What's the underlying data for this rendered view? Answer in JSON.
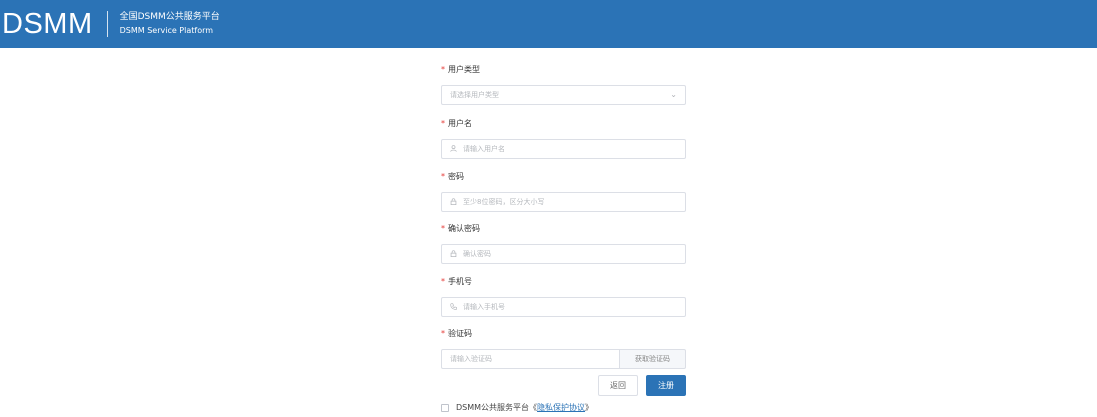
{
  "header": {
    "logo": "DSMM",
    "title_cn": "全国DSMM公共服务平台",
    "title_en": "DSMM Service Platform"
  },
  "form": {
    "user_type": {
      "label": "用户类型",
      "placeholder": "请选择用户类型"
    },
    "username": {
      "label": "用户名",
      "placeholder": "请输入用户名"
    },
    "password": {
      "label": "密码",
      "placeholder": "至少8位密码，区分大小写"
    },
    "confirm_password": {
      "label": "确认密码",
      "placeholder": "确认密码"
    },
    "phone": {
      "label": "手机号",
      "placeholder": "请输入手机号"
    },
    "verify_code": {
      "label": "验证码",
      "placeholder": "请输入验证码",
      "button": "获取验证码"
    }
  },
  "actions": {
    "back": "返回",
    "register": "注册"
  },
  "agreement": {
    "text": "DSMM公共服务平台",
    "link_open": "《",
    "link": "隐私保护协议",
    "link_close": "》"
  },
  "colors": {
    "primary": "#2b73b6",
    "required": "#e53935"
  },
  "icons": {
    "user": "user-icon",
    "lock": "lock-icon",
    "phone": "phone-icon",
    "chevron": "chevron-down-icon"
  }
}
